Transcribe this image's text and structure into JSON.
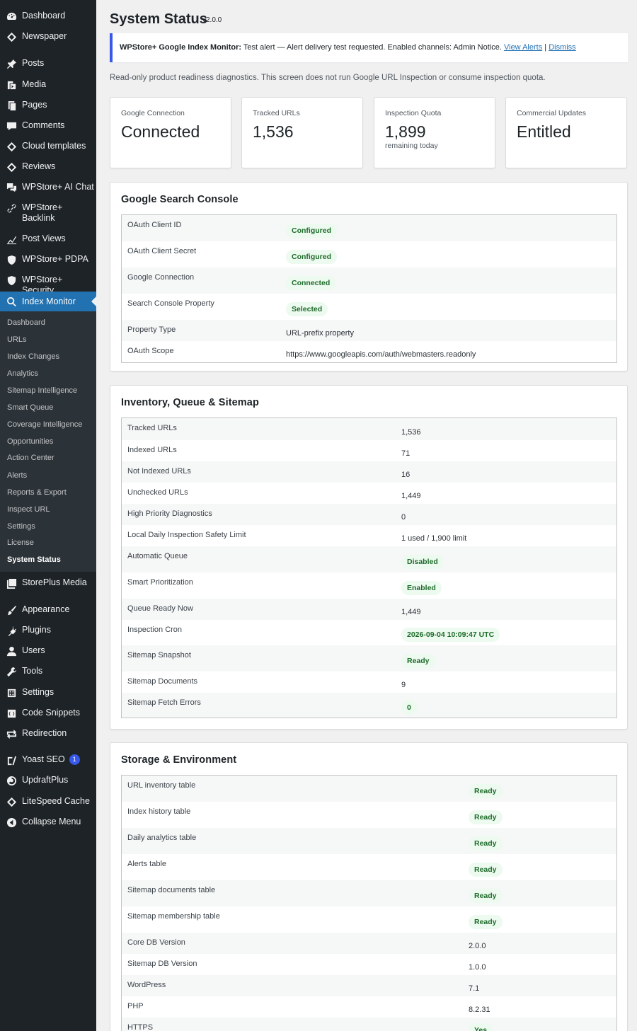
{
  "sidebar": {
    "top": [
      {
        "label": "Dashboard",
        "icon": "dashboard-icon"
      },
      {
        "label": "Newspaper",
        "icon": "newspaper-icon"
      },
      {
        "label": "Posts",
        "icon": "pin-icon"
      },
      {
        "label": "Media",
        "icon": "media-icon"
      },
      {
        "label": "Pages",
        "icon": "pages-icon"
      },
      {
        "label": "Comments",
        "icon": "comment-icon"
      },
      {
        "label": "Cloud templates",
        "icon": "diamond-icon"
      },
      {
        "label": "Reviews",
        "icon": "diamond-icon"
      },
      {
        "label": "WPStore+ AI Chat",
        "icon": "chat-icon"
      },
      {
        "label": "WPStore+ Backlink",
        "icon": "link-icon"
      },
      {
        "label": "Post Views",
        "icon": "chart-icon"
      },
      {
        "label": "WPStore+ PDPA",
        "icon": "shield-icon"
      },
      {
        "label": "WPStore+ Security",
        "icon": "shield-icon"
      },
      {
        "label": "Index Monitor",
        "icon": "search-icon"
      }
    ],
    "submenu": [
      "Dashboard",
      "URLs",
      "Index Changes",
      "Analytics",
      "Sitemap Intelligence",
      "Smart Queue",
      "Coverage Intelligence",
      "Opportunities",
      "Action Center",
      "Alerts",
      "Reports & Export",
      "Inspect URL",
      "Settings",
      "License",
      "System Status"
    ],
    "bottom": [
      {
        "label": "StorePlus Media",
        "icon": "media-library-icon"
      },
      {
        "label": "Appearance",
        "icon": "brush-icon"
      },
      {
        "label": "Plugins",
        "icon": "plug-icon"
      },
      {
        "label": "Users",
        "icon": "user-icon"
      },
      {
        "label": "Tools",
        "icon": "wrench-icon"
      },
      {
        "label": "Settings",
        "icon": "settings-icon"
      },
      {
        "label": "Code Snippets",
        "icon": "code-icon"
      },
      {
        "label": "Redirection",
        "icon": "redirect-icon"
      },
      {
        "label": "Yoast SEO",
        "icon": "yoast-icon",
        "badge": "1"
      },
      {
        "label": "UpdraftPlus",
        "icon": "updraft-icon"
      },
      {
        "label": "LiteSpeed Cache",
        "icon": "diamond-icon"
      },
      {
        "label": "Collapse Menu",
        "icon": "collapse-icon"
      }
    ]
  },
  "header": {
    "title": "System Status",
    "version": "v2.0.0"
  },
  "notice": {
    "prefix": "WPStore+ Google Index Monitor:",
    "message": " Test alert — Alert delivery test requested. Enabled channels: Admin Notice. ",
    "view_link": "View Alerts",
    "separator": " | ",
    "dismiss_link": "Dismiss"
  },
  "intro": "Read-only product readiness diagnostics. This screen does not run Google URL Inspection or consume inspection quota.",
  "stats": [
    {
      "label": "Google Connection",
      "value": "Connected",
      "note": ""
    },
    {
      "label": "Tracked URLs",
      "value": "1,536",
      "note": ""
    },
    {
      "label": "Inspection Quota",
      "value": "1,899",
      "note": "remaining today"
    },
    {
      "label": "Commercial Updates",
      "value": "Entitled",
      "note": ""
    }
  ],
  "panels": [
    {
      "title": "Google Search Console",
      "rows": [
        {
          "key": "OAuth Client ID",
          "value": "Configured",
          "pill": true
        },
        {
          "key": "OAuth Client Secret",
          "value": "Configured",
          "pill": true
        },
        {
          "key": "Google Connection",
          "value": "Connected",
          "pill": true
        },
        {
          "key": "Search Console Property",
          "value": "Selected",
          "pill": true
        },
        {
          "key": "Property Type",
          "value": "URL-prefix property",
          "pill": false
        },
        {
          "key": "OAuth Scope",
          "value": "https://www.googleapis.com/auth/webmasters.readonly",
          "pill": false
        }
      ]
    },
    {
      "title": "Inventory, Queue & Sitemap",
      "rows": [
        {
          "key": "Tracked URLs",
          "value": "1,536",
          "pill": false
        },
        {
          "key": "Indexed URLs",
          "value": "71",
          "pill": false
        },
        {
          "key": "Not Indexed URLs",
          "value": "16",
          "pill": false
        },
        {
          "key": "Unchecked URLs",
          "value": "1,449",
          "pill": false
        },
        {
          "key": "High Priority Diagnostics",
          "value": "0",
          "pill": false
        },
        {
          "key": "Local Daily Inspection Safety Limit",
          "value": "1 used / 1,900 limit",
          "pill": false
        },
        {
          "key": "Automatic Queue",
          "value": "Disabled",
          "pill": true
        },
        {
          "key": "Smart Prioritization",
          "value": "Enabled",
          "pill": true
        },
        {
          "key": "Queue Ready Now",
          "value": "1,449",
          "pill": false
        },
        {
          "key": "Inspection Cron",
          "value": "2026-09-04 10:09:47 UTC",
          "pill": true
        },
        {
          "key": "Sitemap Snapshot",
          "value": "Ready",
          "pill": true
        },
        {
          "key": "Sitemap Documents",
          "value": "9",
          "pill": false
        },
        {
          "key": "Sitemap Fetch Errors",
          "value": "0",
          "pill": true
        }
      ]
    },
    {
      "title": "Storage & Environment",
      "rows": [
        {
          "key": "URL inventory table",
          "value": "Ready",
          "pill": true
        },
        {
          "key": "Index history table",
          "value": "Ready",
          "pill": true
        },
        {
          "key": "Daily analytics table",
          "value": "Ready",
          "pill": true
        },
        {
          "key": "Alerts table",
          "value": "Ready",
          "pill": true
        },
        {
          "key": "Sitemap documents table",
          "value": "Ready",
          "pill": true
        },
        {
          "key": "Sitemap membership table",
          "value": "Ready",
          "pill": true
        },
        {
          "key": "Core DB Version",
          "value": "2.0.0",
          "pill": false
        },
        {
          "key": "Sitemap DB Version",
          "value": "1.0.0",
          "pill": false
        },
        {
          "key": "WordPress",
          "value": "7.1",
          "pill": false
        },
        {
          "key": "PHP",
          "value": "8.2.31",
          "pill": false
        },
        {
          "key": "HTTPS",
          "value": "Yes",
          "pill": true
        }
      ]
    }
  ],
  "colors": {
    "sidebar_bg": "#1d2327",
    "submenu_bg": "#2c3338",
    "accent": "#2271b1",
    "notice_border": "#3858e9",
    "pill_bg": "#edfaef",
    "pill_text": "#1e6b2b"
  }
}
